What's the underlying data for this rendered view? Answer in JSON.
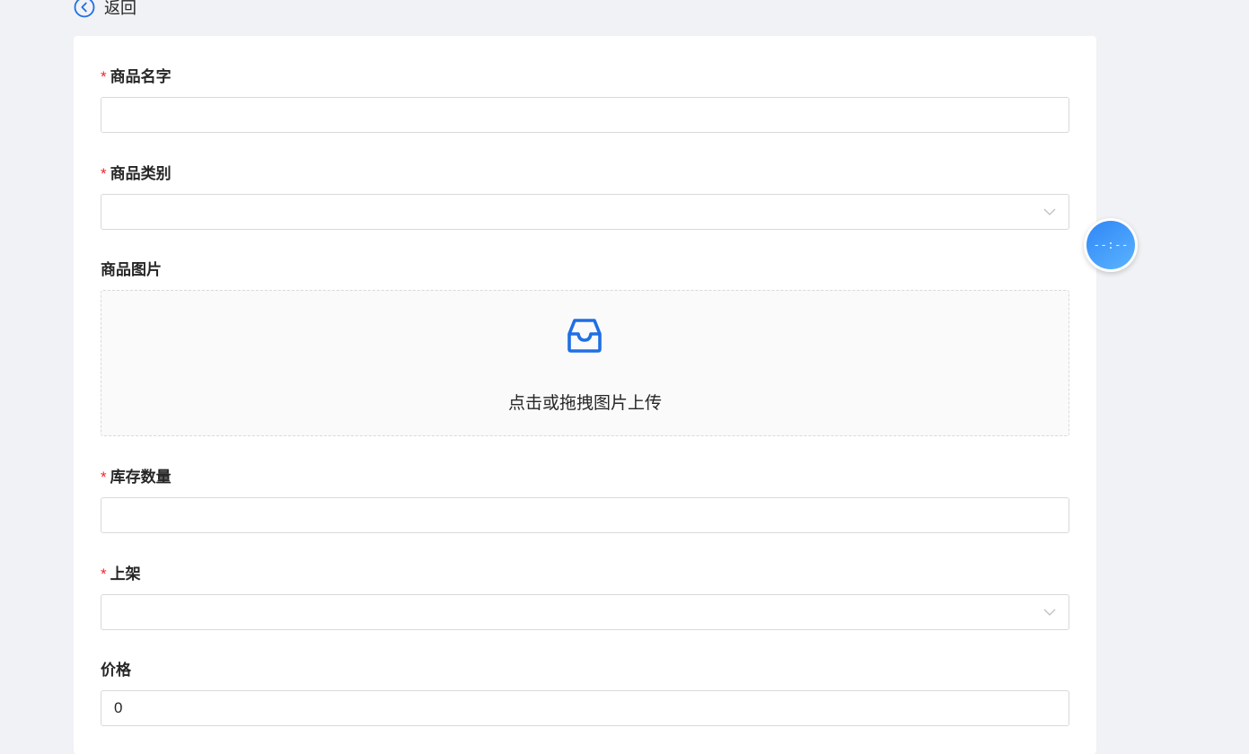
{
  "header": {
    "back_label": "返回"
  },
  "form": {
    "name_label": "商品名字",
    "name_value": "",
    "category_label": "商品类别",
    "category_value": "",
    "image_label": "商品图片",
    "upload_text": "点击或拖拽图片上传",
    "stock_label": "库存数量",
    "stock_value": "",
    "shelf_label": "上架",
    "shelf_value": "",
    "price_label": "价格",
    "price_value": "0",
    "required_mark": "*"
  },
  "timer": {
    "text": "--:--"
  },
  "colors": {
    "accent": "#1f6fe5",
    "required": "#f5222d",
    "border": "#d9d9d9",
    "background": "#f0f2f5"
  },
  "icons": {
    "back": "chevron-left-circle-icon",
    "dropdown": "chevron-down-icon",
    "upload": "inbox-icon"
  }
}
